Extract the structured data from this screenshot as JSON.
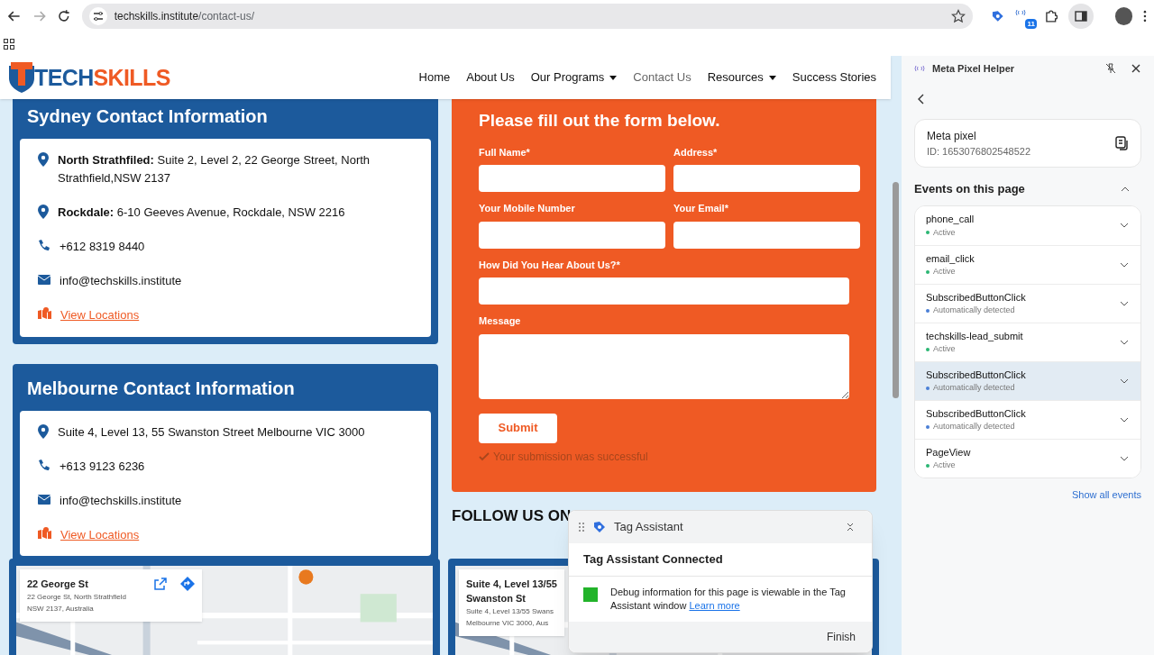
{
  "browser": {
    "url_domain": "techskills.institute",
    "url_path": "/contact-us/",
    "extension_badge": "11"
  },
  "site": {
    "logo": {
      "part1": "TECH",
      "part2": "SKILLS"
    },
    "nav": [
      {
        "label": "Home",
        "selected": false,
        "dropdown": false
      },
      {
        "label": "About Us",
        "selected": false,
        "dropdown": false
      },
      {
        "label": "Our Programs",
        "selected": false,
        "dropdown": true
      },
      {
        "label": "Contact Us",
        "selected": true,
        "dropdown": false
      },
      {
        "label": "Resources",
        "selected": false,
        "dropdown": true
      },
      {
        "label": "Success Stories",
        "selected": false,
        "dropdown": false
      }
    ]
  },
  "contacts": [
    {
      "title": "Sydney Contact Information",
      "items": [
        {
          "kind": "location",
          "label": "North Strathfiled:",
          "text": "Suite 2, Level 2, 22 George Street, North Strathfield,NSW 2137"
        },
        {
          "kind": "location",
          "label": "Rockdale:",
          "text": "6-10 Geeves Avenue, Rockdale, NSW 2216"
        },
        {
          "kind": "phone",
          "text": "+612 8319 8440"
        },
        {
          "kind": "email",
          "text": "info@techskills.institute"
        },
        {
          "kind": "link",
          "text": "View Locations"
        }
      ]
    },
    {
      "title": "Melbourne Contact Information",
      "items": [
        {
          "kind": "location",
          "text": "Suite 4, Level 13, 55 Swanston Street Melbourne VIC 3000"
        },
        {
          "kind": "phone",
          "text": "+613 9123 6236"
        },
        {
          "kind": "email",
          "text": "info@techskills.institute"
        },
        {
          "kind": "link",
          "text": "View Locations"
        }
      ]
    }
  ],
  "form": {
    "title": "Please fill out the form below.",
    "rows": [
      [
        {
          "label": "Full Name*",
          "kind": "input"
        },
        {
          "label": "Address*",
          "kind": "input"
        }
      ],
      [
        {
          "label": "Your Mobile Number",
          "kind": "input"
        },
        {
          "label": "Your Email*",
          "kind": "input"
        }
      ],
      [
        {
          "label": "How Did You Hear About Us?*",
          "kind": "input"
        }
      ],
      [
        {
          "label": "Message",
          "kind": "textarea"
        }
      ]
    ],
    "submit": "Submit",
    "success": "Your submission was successful"
  },
  "follow": "FOLLOW US ON",
  "maps": [
    {
      "title_lines": [
        "22 George St"
      ],
      "address_lines": [
        "22 George St, North Strathfield",
        "NSW 2137, Australia"
      ],
      "actions": true
    },
    {
      "title_lines": [
        "Suite 4, Level 13/55",
        "Swanston St"
      ],
      "address_lines": [
        "Suite 4, Level 13/55 Swans",
        "Melbourne VIC 3000, Aus"
      ],
      "actions": false
    }
  ],
  "tag_assistant": {
    "title": "Tag Assistant",
    "heading": "Tag Assistant Connected",
    "message": "Debug information for this page is viewable in the Tag Assistant window",
    "link": "Learn more",
    "button": "Finish"
  },
  "side_panel": {
    "title": "Meta Pixel Helper",
    "pixel": {
      "name": "Meta pixel",
      "id": "ID: 1653076802548522"
    },
    "events_title": "Events on this page",
    "events": [
      {
        "name": "phone_call",
        "status": "Active",
        "color": "#2bb673",
        "selected": false
      },
      {
        "name": "email_click",
        "status": "Active",
        "color": "#2bb673",
        "selected": false
      },
      {
        "name": "SubscribedButtonClick",
        "status": "Automatically detected",
        "color": "#4a7fd6",
        "selected": false
      },
      {
        "name": "techskills-lead_submit",
        "status": "Active",
        "color": "#2bb673",
        "selected": false
      },
      {
        "name": "SubscribedButtonClick",
        "status": "Automatically detected",
        "color": "#4a7fd6",
        "selected": true
      },
      {
        "name": "SubscribedButtonClick",
        "status": "Automatically detected",
        "color": "#4a7fd6",
        "selected": false
      },
      {
        "name": "PageView",
        "status": "Active",
        "color": "#2bb673",
        "selected": false
      }
    ],
    "show_all": "Show all events"
  }
}
